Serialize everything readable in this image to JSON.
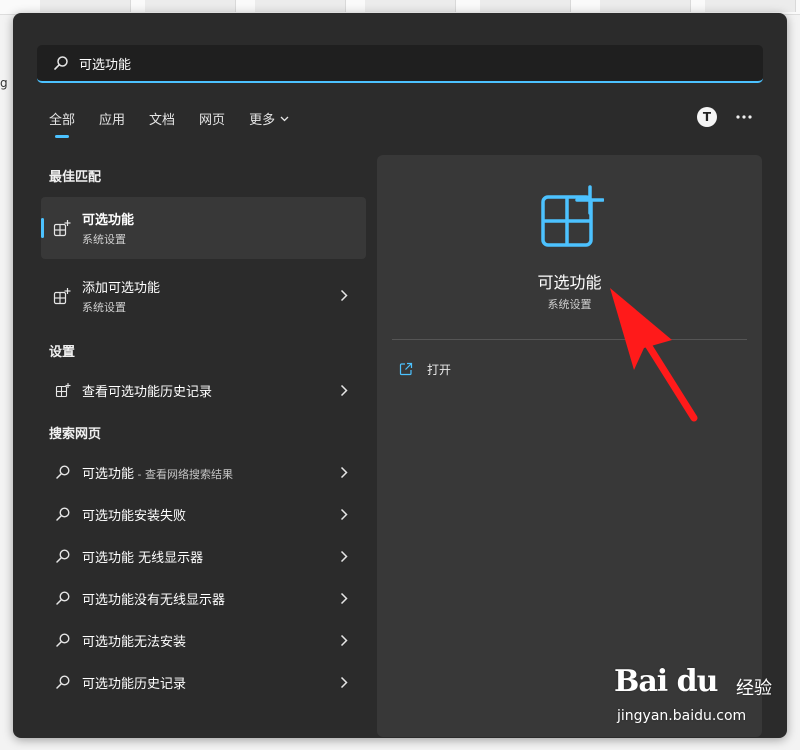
{
  "search": {
    "value": "可选功能"
  },
  "tabs": [
    {
      "label": "全部",
      "active": true
    },
    {
      "label": "应用"
    },
    {
      "label": "文档"
    },
    {
      "label": "网页"
    },
    {
      "label": "更多"
    }
  ],
  "avatar": {
    "initial": "T"
  },
  "sections": {
    "best_match": "最佳匹配",
    "settings": "设置",
    "web": "搜索网页"
  },
  "best_match": {
    "title": "可选功能",
    "subtitle": "系统设置"
  },
  "apps": [
    {
      "title": "添加可选功能",
      "subtitle": "系统设置"
    }
  ],
  "settings_items": [
    {
      "label": "查看可选功能历史记录"
    }
  ],
  "web_items": [
    {
      "label": "可选功能",
      "sub": " - 查看网络搜索结果"
    },
    {
      "label": "可选功能安装失败"
    },
    {
      "label": "可选功能 无线显示器"
    },
    {
      "label": "可选功能没有无线显示器"
    },
    {
      "label": "可选功能无法安装"
    },
    {
      "label": "可选功能历史记录"
    }
  ],
  "detail": {
    "title": "可选功能",
    "subtitle": "系统设置",
    "open_label": "打开"
  },
  "colors": {
    "accent": "#4cc2ff",
    "annotation": "#ff1a1a",
    "panel": "#2b2b2b"
  },
  "watermark": {
    "logo": "Bai du",
    "text": "经验",
    "url": "jingyan.baidu.com"
  }
}
